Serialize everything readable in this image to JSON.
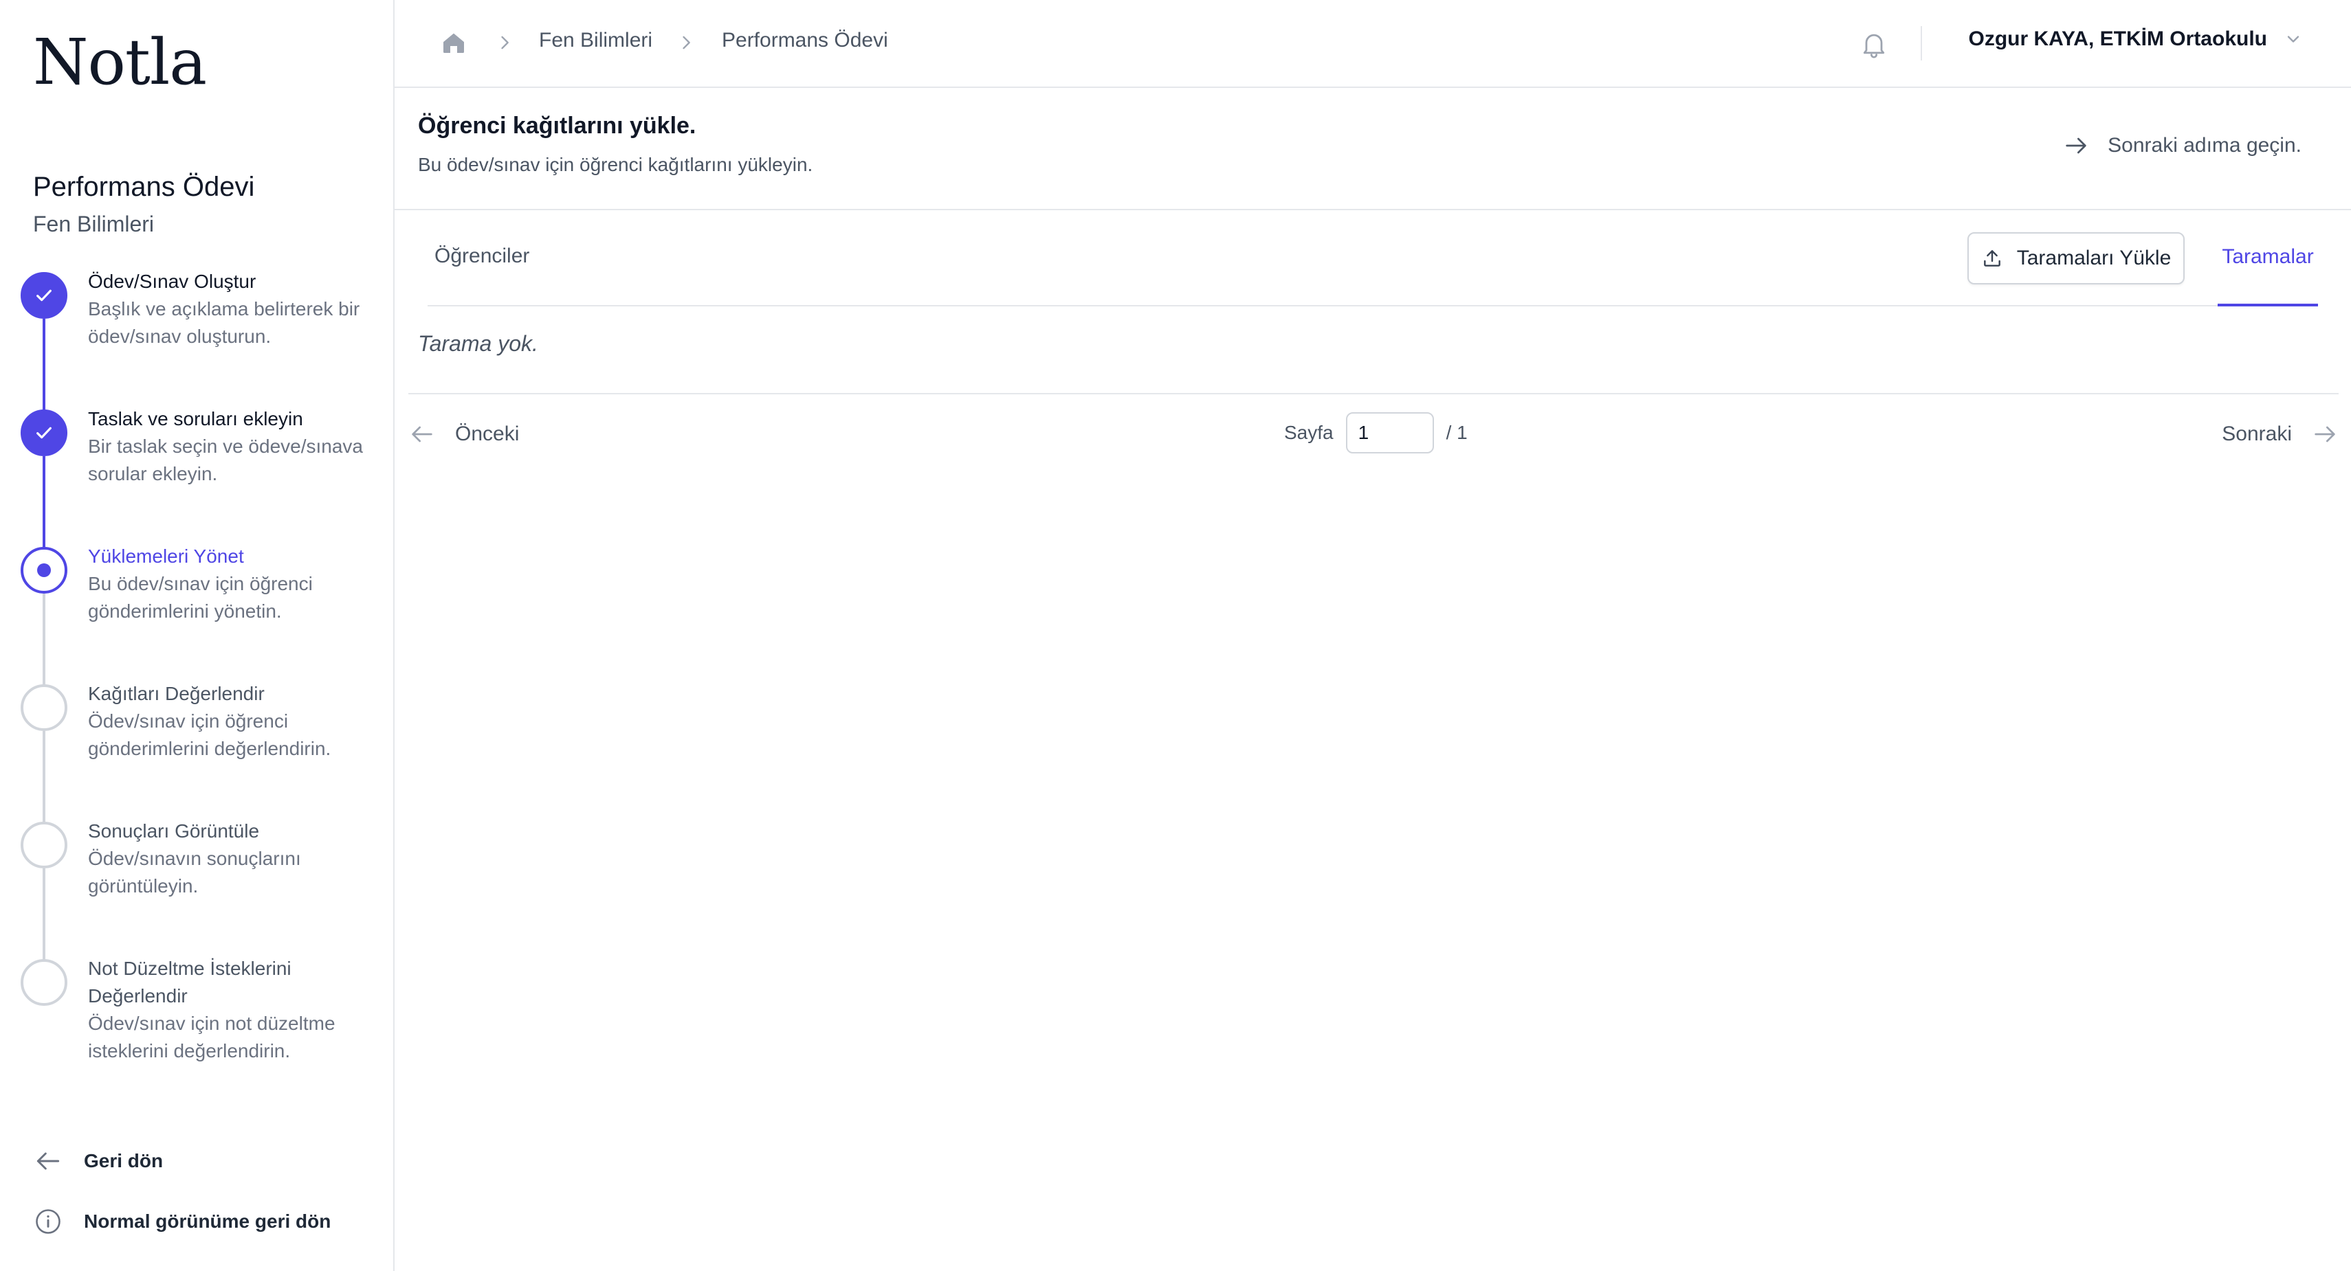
{
  "app": {
    "logo": "Notla"
  },
  "sidebar": {
    "assignment_title": "Performans Ödevi",
    "course": "Fen Bilimleri",
    "steps": [
      {
        "title": "Ödev/Sınav Oluştur",
        "description": "Başlık ve açıklama belirterek bir ödev/sınav oluşturun.",
        "status": "complete"
      },
      {
        "title": "Taslak ve soruları ekleyin",
        "description": "Bir taslak seçin ve ödeve/sınava sorular ekleyin.",
        "status": "complete"
      },
      {
        "title": "Yüklemeleri Yönet",
        "description": "Bu ödev/sınav için öğrenci gönderimlerini yönetin.",
        "status": "current"
      },
      {
        "title": "Kağıtları Değerlendir",
        "description": "Ödev/sınav için öğrenci gönderimlerini değerlendirin.",
        "status": "upcoming"
      },
      {
        "title": "Sonuçları Görüntüle",
        "description": "Ödev/sınavın sonuçlarını görüntüleyin.",
        "status": "upcoming"
      },
      {
        "title": "Not Düzeltme İsteklerini Değerlendir",
        "description": "Ödev/sınav için not düzeltme isteklerini değerlendirin.",
        "status": "upcoming"
      }
    ],
    "back_label": "Geri dön",
    "normal_view_label": "Normal görünüme geri dön"
  },
  "header": {
    "breadcrumb": [
      "Fen Bilimleri",
      "Performans Ödevi"
    ],
    "user": "Ozgur KAYA, ETKİM Ortaokulu"
  },
  "section": {
    "title": "Öğrenci kağıtlarını yükle.",
    "description": "Bu ödev/sınav için öğrenci kağıtlarını yükleyin.",
    "next_step_label": "Sonraki adıma geçin."
  },
  "tabs": {
    "students": "Öğrenciler",
    "upload_button": "Taramaları Yükle",
    "scans": "Taramalar"
  },
  "content": {
    "empty_text": "Tarama yok."
  },
  "pagination": {
    "prev_label": "Önceki",
    "page_label": "Sayfa",
    "current_page": "1",
    "total_pages": "/ 1",
    "next_label": "Sonraki"
  },
  "colors": {
    "accent": "#4f46e5",
    "border": "#e5e7eb",
    "muted_text": "#4b5563"
  }
}
